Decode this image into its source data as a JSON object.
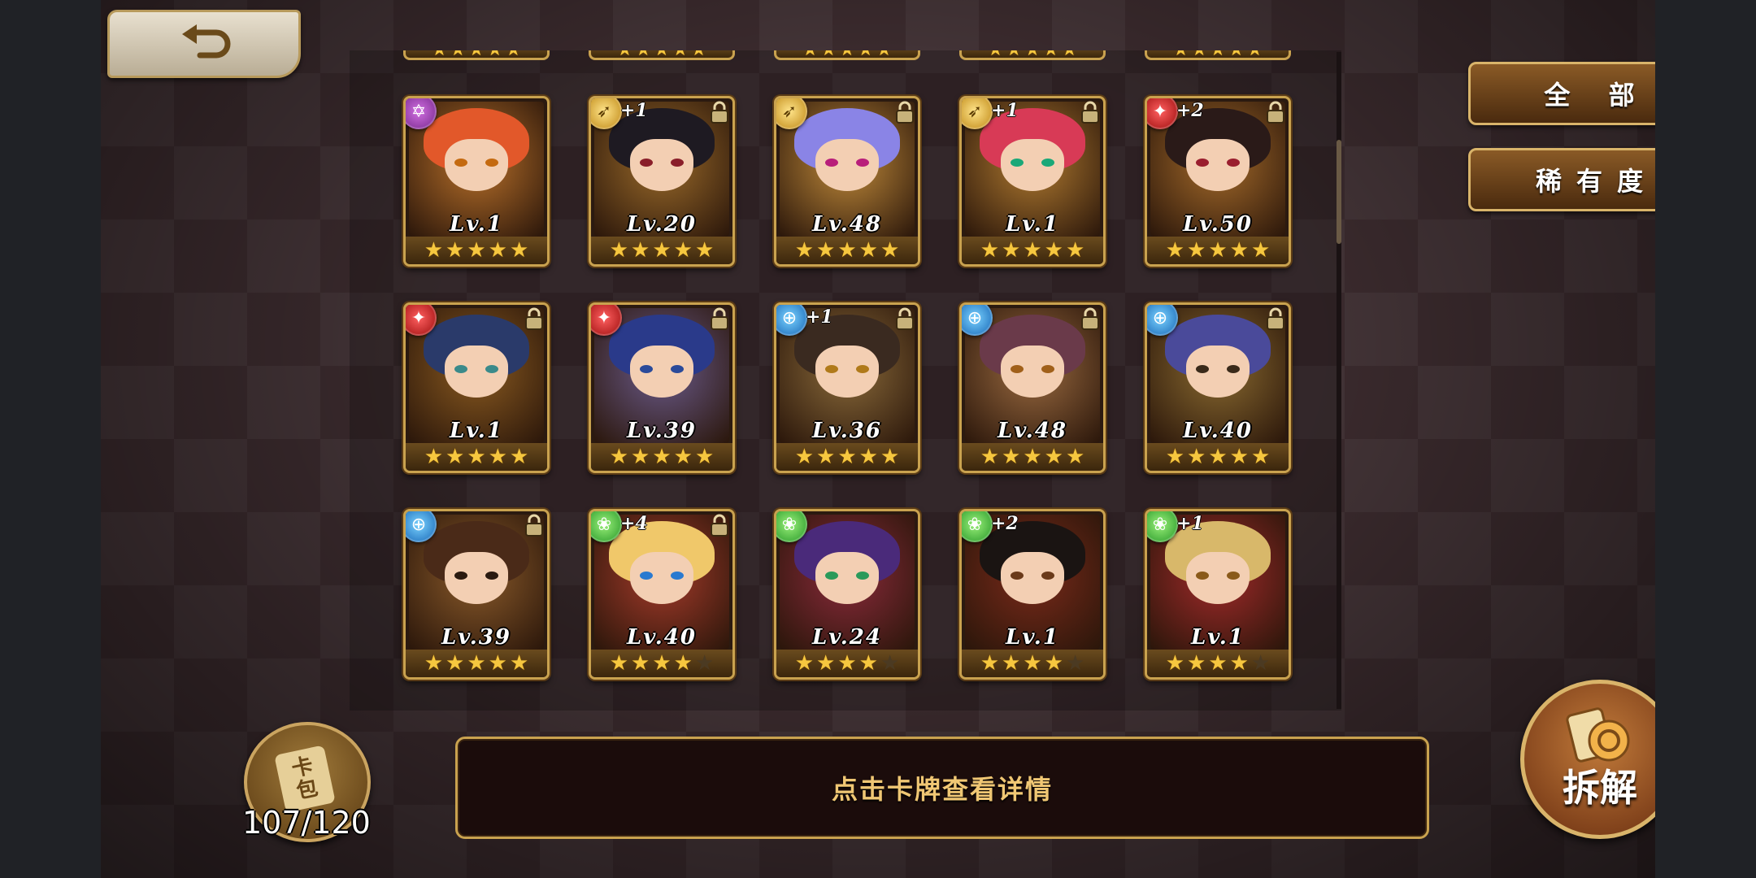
{
  "nav": {
    "back_icon": "back-arrow-icon"
  },
  "filters": {
    "all_label": "全 部",
    "rarity_label": "稀有度"
  },
  "hint": {
    "text": "点击卡牌查看详情"
  },
  "pack": {
    "label_top": "卡",
    "label_bottom": "包",
    "count": "107/120"
  },
  "dismantle": {
    "label": "拆解"
  },
  "colors": {
    "accent_gold": "#c9a24f",
    "hint_text": "#f0c774",
    "star_on": "#f6c73f"
  },
  "cards": [
    {
      "level": "Lv.1",
      "stars": 5,
      "element": "purple",
      "plus": "",
      "locked": false,
      "hair": "#e2582a",
      "eye": "#c46a10",
      "bg": "#b8702a"
    },
    {
      "level": "Lv.20",
      "stars": 5,
      "element": "gold",
      "plus": "+1",
      "locked": true,
      "hair": "#1e1a22",
      "eye": "#8a1e2a",
      "bg": "#9a6a2a"
    },
    {
      "level": "Lv.48",
      "stars": 5,
      "element": "gold",
      "plus": "",
      "locked": true,
      "hair": "#8a84e6",
      "eye": "#b81e7a",
      "bg": "#c08a3a"
    },
    {
      "level": "Lv.1",
      "stars": 5,
      "element": "gold",
      "plus": "+1",
      "locked": true,
      "hair": "#d83a56",
      "eye": "#1aa878",
      "bg": "#b07a30"
    },
    {
      "level": "Lv.50",
      "stars": 5,
      "element": "red",
      "plus": "+2",
      "locked": true,
      "hair": "#2a1a18",
      "eye": "#9a1e2e",
      "bg": "#a46a2a"
    },
    {
      "level": "Lv.1",
      "stars": 5,
      "element": "red",
      "plus": "",
      "locked": true,
      "hair": "#2a3a6a",
      "eye": "#3a8a8a",
      "bg": "#8a5a20"
    },
    {
      "level": "Lv.39",
      "stars": 5,
      "element": "red",
      "plus": "",
      "locked": true,
      "hair": "#2a3a8a",
      "eye": "#2a4a9a",
      "bg": "#6a5a8a"
    },
    {
      "level": "Lv.36",
      "stars": 5,
      "element": "blue",
      "plus": "+1",
      "locked": true,
      "hair": "#3a2a20",
      "eye": "#b07a1a",
      "bg": "#8a6a3a"
    },
    {
      "level": "Lv.48",
      "stars": 5,
      "element": "blue",
      "plus": "",
      "locked": true,
      "hair": "#6a3a4a",
      "eye": "#a0601a",
      "bg": "#9a6a40"
    },
    {
      "level": "Lv.40",
      "stars": 5,
      "element": "blue",
      "plus": "",
      "locked": true,
      "hair": "#4a4a9a",
      "eye": "#3a2a1a",
      "bg": "#8a6a30"
    },
    {
      "level": "Lv.39",
      "stars": 5,
      "element": "blue",
      "plus": "",
      "locked": true,
      "hair": "#4a2a18",
      "eye": "#2a1a10",
      "bg": "#8a5a2a"
    },
    {
      "level": "Lv.40",
      "stars": 4,
      "element": "green",
      "plus": "+4",
      "locked": true,
      "hair": "#f0c86a",
      "eye": "#2a7ad0",
      "bg": "#a43a2a"
    },
    {
      "level": "Lv.24",
      "stars": 4,
      "element": "green",
      "plus": "",
      "locked": false,
      "hair": "#4a2a7a",
      "eye": "#2a9a5a",
      "bg": "#8a2a3a"
    },
    {
      "level": "Lv.1",
      "stars": 4,
      "element": "green",
      "plus": "+2",
      "locked": false,
      "hair": "#1a1412",
      "eye": "#6a3a1a",
      "bg": "#7a2a1a"
    },
    {
      "level": "Lv.1",
      "stars": 4,
      "element": "green",
      "plus": "+1",
      "locked": false,
      "hair": "#d8b86a",
      "eye": "#8a5a1a",
      "bg": "#a22a2a"
    }
  ]
}
